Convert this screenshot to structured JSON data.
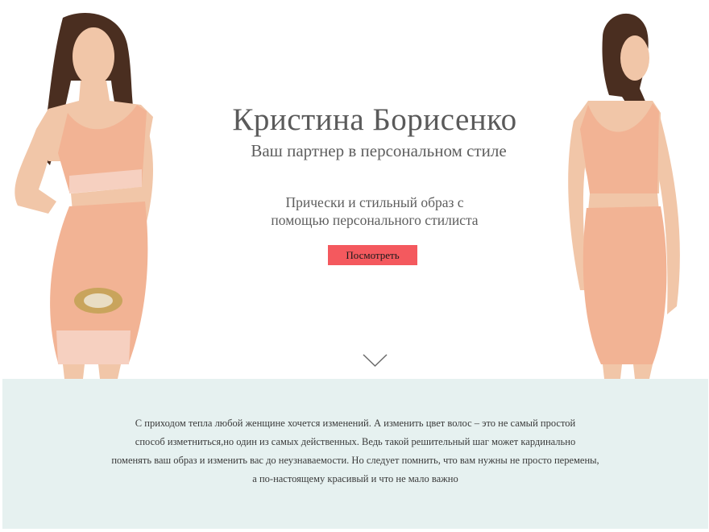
{
  "hero": {
    "title": "Кристина Борисенко",
    "subtitle": "Ваш партнер в персональном стиле",
    "description_lines": [
      "Прически и стильный образ с",
      "помощью персонального стилиста"
    ],
    "cta_label": "Посмотреть"
  },
  "info": {
    "lines": [
      "С приходом тепла любой женщине хочется изменений. А изменить цвет волос – это не самый простой",
      "способ изметниться,но один из самых действенных. Ведь такой решительный шаг может кардинально",
      "поменять ваш образ и изменить вас до неузнаваемости. Но следует помнить, что вам нужны не просто перемены,",
      "а по-настоящему красивый и что не мало важно"
    ]
  },
  "colors": {
    "cta_background": "#f4595e",
    "info_background": "#e6f1f0",
    "dress": "#f2b394",
    "hair": "#4a2e20",
    "skin": "#f1c6a8"
  },
  "icons": {
    "scroll_down": "chevron-down-icon"
  }
}
